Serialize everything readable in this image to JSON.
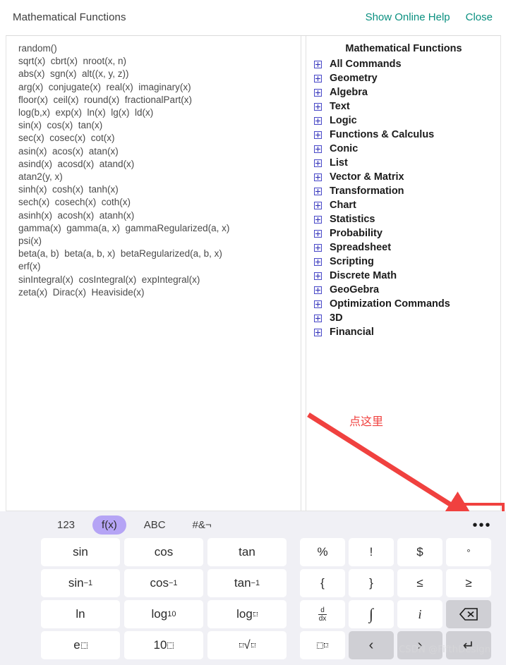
{
  "header": {
    "title": "Mathematical Functions",
    "links": [
      {
        "label": "Show Online Help"
      },
      {
        "label": "Close"
      }
    ],
    "link_color": "#0a9080"
  },
  "left_panel": {
    "lines": [
      "random()",
      "sqrt(x)  cbrt(x)  nroot(x, n)",
      "abs(x)  sgn(x)  alt((x, y, z))",
      "arg(x)  conjugate(x)  real(x)  imaginary(x)",
      "floor(x)  ceil(x)  round(x)  fractionalPart(x)",
      "log(b,x)  exp(x)  ln(x)  lg(x)  ld(x)",
      "sin(x)  cos(x)  tan(x)",
      "sec(x)  cosec(x)  cot(x)",
      "asin(x)  acos(x)  atan(x)",
      "asind(x)  acosd(x)  atand(x)",
      "atan2(y, x)",
      "sinh(x)  cosh(x)  tanh(x)",
      "sech(x)  cosech(x)  coth(x)",
      "asinh(x)  acosh(x)  atanh(x)",
      "gamma(x)  gamma(a, x)  gammaRegularized(a, x)",
      "psi(x)",
      "beta(a, b)  beta(a, b, x)  betaRegularized(a, b, x)",
      "erf(x)",
      "sinIntegral(x)  cosIntegral(x)  expIntegral(x)",
      "zeta(x)  Dirac(x)  Heaviside(x)"
    ]
  },
  "right_panel": {
    "title": "Mathematical Functions",
    "items": [
      {
        "label": "All Commands"
      },
      {
        "label": "Geometry"
      },
      {
        "label": "Algebra"
      },
      {
        "label": "Text"
      },
      {
        "label": "Logic"
      },
      {
        "label": "Functions & Calculus"
      },
      {
        "label": "Conic"
      },
      {
        "label": "List"
      },
      {
        "label": "Vector & Matrix"
      },
      {
        "label": "Transformation"
      },
      {
        "label": "Chart"
      },
      {
        "label": "Statistics"
      },
      {
        "label": "Probability"
      },
      {
        "label": "Spreadsheet"
      },
      {
        "label": "Scripting"
      },
      {
        "label": "Discrete Math"
      },
      {
        "label": "GeoGebra"
      },
      {
        "label": "Optimization Commands"
      },
      {
        "label": "3D"
      },
      {
        "label": "Financial"
      }
    ]
  },
  "annotation": {
    "text": "点这里",
    "color": "#f0413f"
  },
  "keyboard": {
    "tabs": [
      {
        "label": "123",
        "active": false
      },
      {
        "label": "f(x)",
        "active": true
      },
      {
        "label": "ABC",
        "active": false
      },
      {
        "label": "#&¬",
        "active": false
      }
    ],
    "active_tab_color": "#b5a4f5",
    "more_label": "•••",
    "rows": [
      {
        "left": [
          {
            "label": "sin",
            "type": "text"
          },
          {
            "label": "cos",
            "type": "text"
          },
          {
            "label": "tan",
            "type": "text"
          }
        ],
        "right": [
          {
            "label": "%",
            "type": "text"
          },
          {
            "label": "!",
            "type": "text"
          },
          {
            "label": "$",
            "type": "text"
          },
          {
            "label": "°",
            "type": "degree"
          }
        ]
      },
      {
        "left": [
          {
            "label": "sin⁻¹",
            "type": "inverse",
            "base": "sin"
          },
          {
            "label": "cos⁻¹",
            "type": "inverse",
            "base": "cos"
          },
          {
            "label": "tan⁻¹",
            "type": "inverse",
            "base": "tan"
          }
        ],
        "right": [
          {
            "label": "{",
            "type": "text"
          },
          {
            "label": "}",
            "type": "text"
          },
          {
            "label": "≤",
            "type": "text"
          },
          {
            "label": "≥",
            "type": "text"
          }
        ]
      },
      {
        "left": [
          {
            "label": "ln",
            "type": "text"
          },
          {
            "label": "log10",
            "type": "logbase",
            "base": "log",
            "sub": "10"
          },
          {
            "label": "log□",
            "type": "logsub",
            "base": "log"
          }
        ],
        "right": [
          {
            "label": "d/dx",
            "type": "fraction",
            "num": "d",
            "den": "dx"
          },
          {
            "label": "∫",
            "type": "integral"
          },
          {
            "label": "i",
            "type": "italic"
          },
          {
            "label": "backspace",
            "type": "backspace",
            "gray": true
          }
        ]
      },
      {
        "left": [
          {
            "label": "e^□",
            "type": "power",
            "base": "e"
          },
          {
            "label": "10^□",
            "type": "power",
            "base": "10"
          },
          {
            "label": "nroot",
            "type": "nroot"
          }
        ],
        "right": [
          {
            "label": "□^□",
            "type": "boxpower"
          },
          {
            "label": "‹",
            "type": "arrow-left",
            "gray": true
          },
          {
            "label": "›",
            "type": "arrow-right",
            "gray": true
          },
          {
            "label": "↵",
            "type": "enter",
            "gray": true
          }
        ]
      }
    ]
  },
  "watermark": "CSDN @FifthDesign"
}
